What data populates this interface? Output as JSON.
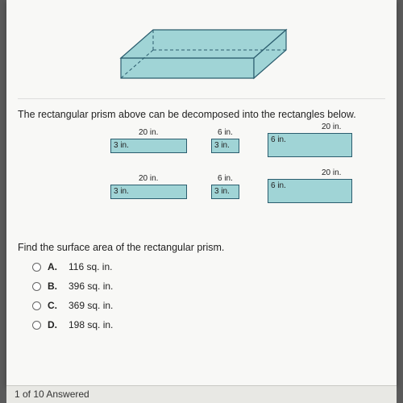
{
  "intro_text": "The rectangular prism above can be decomposed into the rectangles below.",
  "labels": {
    "r1_top": "20 in.",
    "r1_in": "3 in.",
    "r2_top": "6 in.",
    "r2_in": "3 in.",
    "r3_top": "20 in.",
    "r3_in": "6 in.",
    "r4_top": "20 in.",
    "r4_in": "3 in.",
    "r5_top": "6 in.",
    "r5_in": "3 in.",
    "r6_top": "20 in.",
    "r6_in": "6 in."
  },
  "question_text": "Find the surface area of the rectangular prism.",
  "choices": [
    {
      "letter": "A.",
      "text": "116 sq. in."
    },
    {
      "letter": "B.",
      "text": "396 sq. in."
    },
    {
      "letter": "C.",
      "text": "369 sq. in."
    },
    {
      "letter": "D.",
      "text": "198 sq. in."
    }
  ],
  "footer_text": "1 of 10 Answered"
}
